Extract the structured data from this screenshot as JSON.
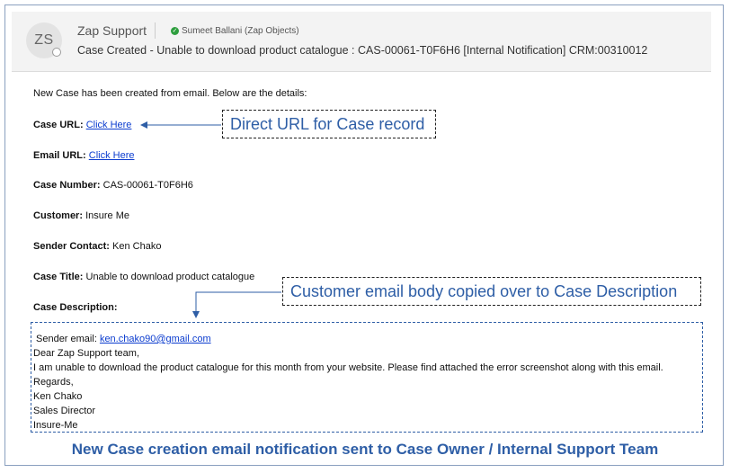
{
  "header": {
    "avatar_initials": "ZS",
    "sender_name": "Zap Support",
    "on_behalf": "Sumeet Ballani (Zap Objects)",
    "subject": "Case Created - Unable to download product catalogue : CAS-00061-T0F6H6 [Internal Notification] CRM:00310012"
  },
  "body": {
    "intro": "New Case has been created from email. Below are the details:",
    "case_url_label": "Case URL:",
    "case_url_link": "Click Here",
    "email_url_label": "Email URL:",
    "email_url_link": "Click Here",
    "case_number_label": "Case Number:",
    "case_number_value": "CAS-00061-T0F6H6",
    "customer_label": "Customer:",
    "customer_value": "Insure Me",
    "sender_contact_label": "Sender Contact:",
    "sender_contact_value": "Ken Chako",
    "case_title_label": "Case Title:",
    "case_title_value": "Unable to download product catalogue",
    "case_description_label": "Case Description:"
  },
  "description": {
    "sender_email_label": "Sender email:",
    "sender_email_value": "ken.chako90@gmail.com",
    "lines": [
      "Dear Zap Support team,",
      "I am unable to download the product catalogue for this month from your website. Please find attached the error screenshot along with this email.",
      "Regards,",
      "Ken Chako",
      "Sales Director",
      "Insure-Me"
    ]
  },
  "callouts": {
    "case_url": "Direct URL for Case record",
    "description": "Customer email body copied over to Case Description"
  },
  "caption": "New Case creation email notification sent to Case Owner / Internal Support Team",
  "colors": {
    "accent": "#2e5ea6",
    "link": "#0b3ccf",
    "presence_ok": "#2e9e3e"
  }
}
